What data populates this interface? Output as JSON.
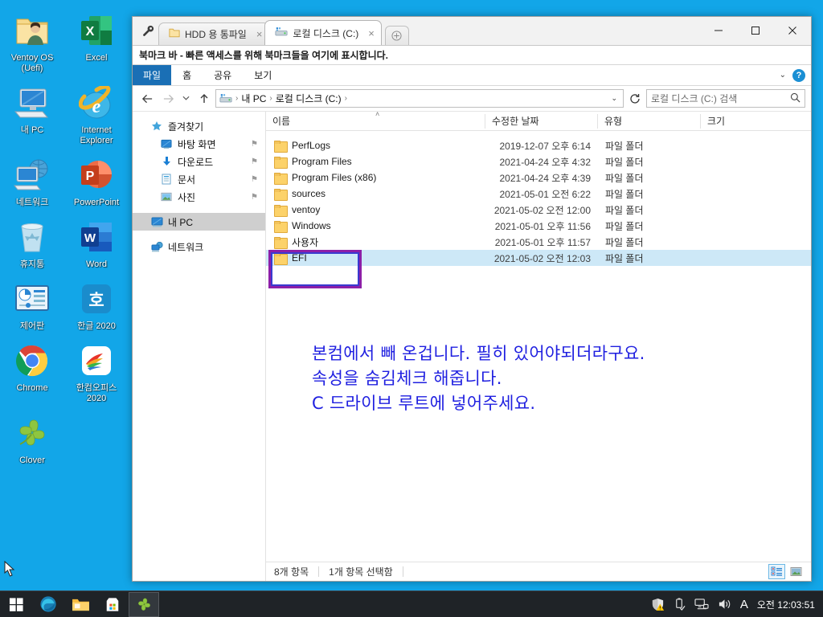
{
  "desktop": {
    "icons": [
      {
        "label": "Ventoy OS\n(Uefi)",
        "icon": "folder-user-icon"
      },
      {
        "label": "Excel",
        "icon": "excel-icon"
      },
      {
        "label": "내 PC",
        "icon": "this-pc-icon"
      },
      {
        "label": "Internet\nExplorer",
        "icon": "internet-explorer-icon"
      },
      {
        "label": "네트워크",
        "icon": "network-icon"
      },
      {
        "label": "PowerPoint",
        "icon": "powerpoint-icon"
      },
      {
        "label": "휴지통",
        "icon": "recycle-bin-icon"
      },
      {
        "label": "Word",
        "icon": "word-icon"
      },
      {
        "label": "제어판",
        "icon": "control-panel-icon"
      },
      {
        "label": "한글 2020",
        "icon": "hangul-icon"
      },
      {
        "label": "Chrome",
        "icon": "chrome-icon"
      },
      {
        "label": "한컴오피스\n2020",
        "icon": "hancom-office-icon"
      },
      {
        "label": "Clover",
        "icon": "clover-icon"
      }
    ]
  },
  "window": {
    "tabs": [
      {
        "label": "HDD 용 통파일",
        "icon": "folder-icon",
        "active": false,
        "close": "×"
      },
      {
        "label": "로컬 디스크 (C:)",
        "icon": "drive-icon",
        "active": true,
        "close": "×"
      }
    ],
    "new_tab_label": "+",
    "controls": {
      "minimize": "—",
      "maximize": "☐",
      "close": "✕"
    },
    "bookmark_bar_text": "북마크 바 - 빠른 액세스를 위해 북마크들을 여기에 표시합니다.",
    "ribbon": {
      "file": "파일",
      "items": [
        "홈",
        "공유",
        "보기"
      ],
      "collapse": "˅",
      "help": "?"
    },
    "address": {
      "back": "←",
      "forward": "→",
      "recent": "˅",
      "up": "↑",
      "crumbs": [
        "내 PC",
        "로컬 디스크 (C:)"
      ],
      "separator": "›",
      "dropdown_caret": "˅",
      "refresh": "↻"
    },
    "search": {
      "placeholder": "로컬 디스크 (C:) 검색",
      "value": "",
      "icon": "search-icon"
    }
  },
  "navpane": {
    "groups": [
      {
        "header": {
          "label": "즐겨찾기",
          "icon": "star-icon"
        },
        "items": [
          {
            "label": "바탕 화면",
            "icon": "desktop-icon",
            "pinned": true
          },
          {
            "label": "다운로드",
            "icon": "downloads-icon",
            "pinned": true
          },
          {
            "label": "문서",
            "icon": "documents-icon",
            "pinned": true
          },
          {
            "label": "사진",
            "icon": "pictures-icon",
            "pinned": true
          }
        ]
      },
      {
        "header": {
          "label": "내 PC",
          "icon": "this-pc-icon",
          "selected": true
        },
        "items": []
      },
      {
        "header": {
          "label": "네트워크",
          "icon": "network-icon"
        },
        "items": []
      }
    ],
    "pin_glyph": "⚑"
  },
  "filelist": {
    "columns": [
      {
        "key": "name",
        "label": "이름",
        "sorted": true,
        "sort_glyph": "˄"
      },
      {
        "key": "date",
        "label": "수정한 날짜"
      },
      {
        "key": "type",
        "label": "유형"
      },
      {
        "key": "size",
        "label": "크기"
      }
    ],
    "rows": [
      {
        "name": "PerfLogs",
        "date": "2019-12-07 오후 6:14",
        "type": "파일 폴더",
        "size": "",
        "selected": false
      },
      {
        "name": "Program Files",
        "date": "2021-04-24 오후 4:32",
        "type": "파일 폴더",
        "size": "",
        "selected": false
      },
      {
        "name": "Program Files (x86)",
        "date": "2021-04-24 오후 4:39",
        "type": "파일 폴더",
        "size": "",
        "selected": false
      },
      {
        "name": "sources",
        "date": "2021-05-01 오전 6:22",
        "type": "파일 폴더",
        "size": "",
        "selected": false
      },
      {
        "name": "ventoy",
        "date": "2021-05-02 오전 12:00",
        "type": "파일 폴더",
        "size": "",
        "selected": false
      },
      {
        "name": "Windows",
        "date": "2021-05-01 오후 11:56",
        "type": "파일 폴더",
        "size": "",
        "selected": false
      },
      {
        "name": "사용자",
        "date": "2021-05-01 오후 11:57",
        "type": "파일 폴더",
        "size": "",
        "selected": false
      },
      {
        "name": "EFI",
        "date": "2021-05-02 오전 12:03",
        "type": "파일 폴더",
        "size": "",
        "selected": true
      }
    ]
  },
  "annotation": {
    "text": "본컴에서 빼 온겁니다. 필히 있어야되더라구요.\n속성을 숨김체크 해줍니다.\nC 드라이브 루트에 넣어주세요.",
    "color": "#1f1fe0"
  },
  "statusbar": {
    "item_count": "8개 항목",
    "selection": "1개 항목 선택함",
    "views": [
      {
        "name": "details-view",
        "active": true
      },
      {
        "name": "large-icons-view",
        "active": false
      }
    ]
  },
  "taskbar": {
    "start": "start-icon",
    "buttons": [
      {
        "name": "edge-icon",
        "running": false
      },
      {
        "name": "file-explorer-icon",
        "running": false
      },
      {
        "name": "microsoft-store-icon",
        "running": false
      },
      {
        "name": "clover-icon",
        "running": true
      }
    ],
    "tray": [
      {
        "name": "security-warning-icon"
      },
      {
        "name": "usb-eject-icon"
      },
      {
        "name": "network-icon"
      },
      {
        "name": "volume-icon"
      },
      {
        "name": "ime-indicator",
        "label": "A"
      }
    ],
    "clock": "오전 12:03:51"
  },
  "colors": {
    "desktop": "#12a6e8",
    "accent": "#1a6fb5",
    "selection": "#cde8f7",
    "highlight_outer": "#8c1fa8",
    "highlight_inner": "#3a3ad0",
    "taskbar": "#1f2327"
  }
}
